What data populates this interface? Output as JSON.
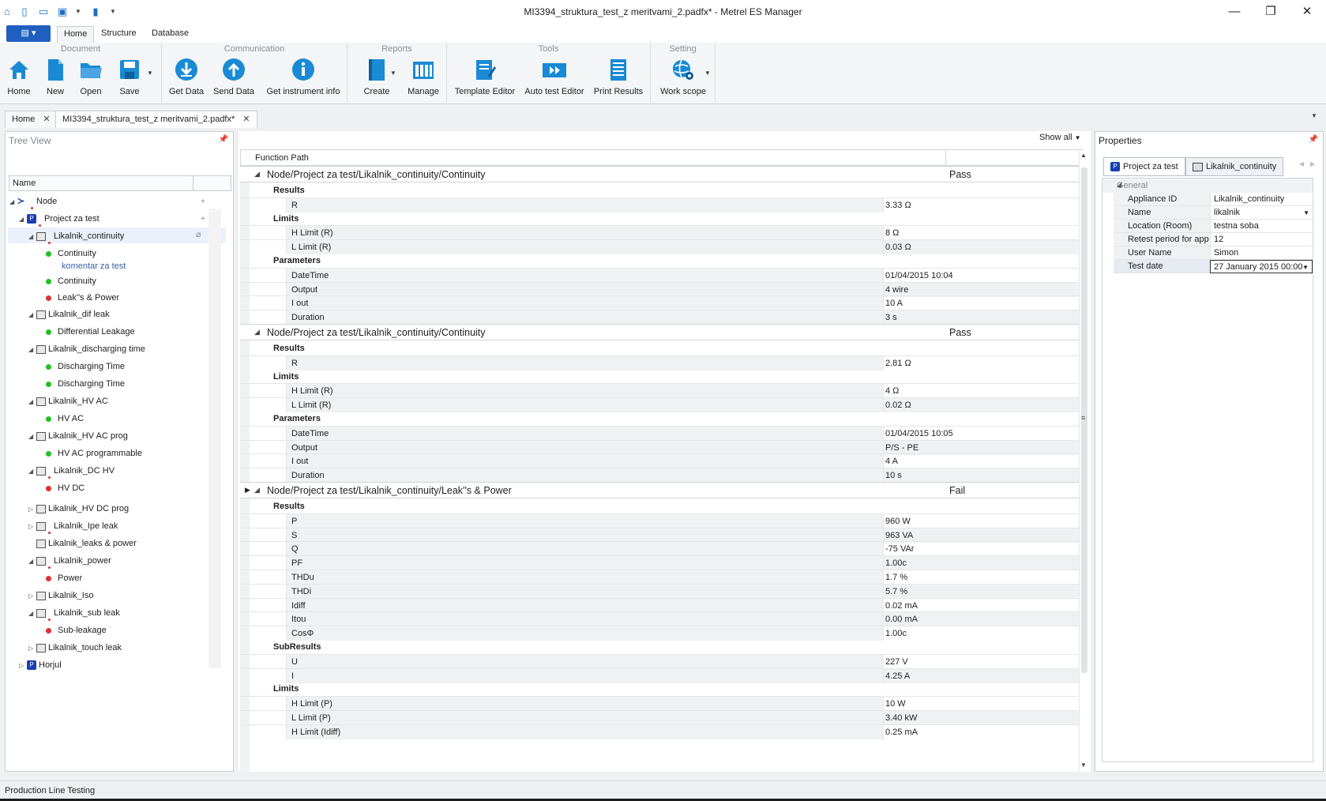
{
  "window": {
    "title": "MI3394_struktura_test_z meritvami_2.padfx* - Metrel ES Manager"
  },
  "ribbon": {
    "tabs": [
      "Home",
      "Structure",
      "Database"
    ],
    "groups": {
      "document": {
        "title": "Document",
        "buttons": [
          "Home",
          "New",
          "Open",
          "Save"
        ]
      },
      "communication": {
        "title": "Communication",
        "buttons": [
          "Get Data",
          "Send Data",
          "Get instrument info"
        ]
      },
      "reports": {
        "title": "Reports",
        "buttons": [
          "Create",
          "Manage"
        ]
      },
      "tools": {
        "title": "Tools",
        "buttons": [
          "Template Editor",
          "Auto test Editor",
          "Print Results"
        ]
      },
      "setting": {
        "title": "Setting",
        "buttons": [
          "Work scope"
        ]
      }
    }
  },
  "doc_tabs": [
    "Home",
    "MI3394_struktura_test_z meritvami_2.padfx*"
  ],
  "tree": {
    "title": "Tree View",
    "column": "Name",
    "nodes": [
      "Node",
      "Project za test",
      "Likalnik_continuity",
      "Continuity",
      "komentar za test",
      "Continuity",
      "Leak''s & Power",
      "Likalnik_dif leak",
      "Differential Leakage",
      "Likalnik_discharging time",
      "Discharging Time",
      "Discharging Time",
      "Likalnik_HV AC",
      "HV AC",
      "Likalnik_HV AC prog",
      "HV AC programmable",
      "Likalnik_DC HV",
      "HV DC",
      "Likalnik_HV DC prog",
      "Likalnik_Ipe leak",
      "Likalnik_leaks & power",
      "Likalnik_power",
      "Power",
      "Likalnik_Iso",
      "Likalnik_sub leak",
      "Sub-leakage",
      "Likalnik_touch leak",
      "Horjul"
    ]
  },
  "center": {
    "show_all": "Show all",
    "column_header": "Function Path",
    "groups": [
      {
        "path": "Node/Project za test/Likalnik_continuity/Continuity",
        "status": "Pass",
        "sections": [
          {
            "title": "Results",
            "rows": [
              {
                "name": "R",
                "value": "3.33 Ω",
                "result": "Pass"
              }
            ]
          },
          {
            "title": "Limits",
            "rows": [
              {
                "name": "H Limit  (R)",
                "value": "8 Ω",
                "result": ""
              },
              {
                "name": "L Limit  (R)",
                "value": "0.03 Ω",
                "result": ""
              }
            ]
          },
          {
            "title": "Parameters",
            "rows": [
              {
                "name": "DateTime",
                "value": "01/04/2015 10:04",
                "result": ""
              },
              {
                "name": "Output",
                "value": "4 wire",
                "result": ""
              },
              {
                "name": "I out",
                "value": "10 A",
                "result": ""
              },
              {
                "name": "Duration",
                "value": "3 s",
                "result": ""
              }
            ]
          }
        ]
      },
      {
        "path": "Node/Project za test/Likalnik_continuity/Continuity",
        "status": "Pass",
        "sections": [
          {
            "title": "Results",
            "rows": [
              {
                "name": "R",
                "value": "2.81 Ω",
                "result": "Pass"
              }
            ]
          },
          {
            "title": "Limits",
            "rows": [
              {
                "name": "H Limit  (R)",
                "value": "4 Ω",
                "result": ""
              },
              {
                "name": "L Limit  (R)",
                "value": "0.02 Ω",
                "result": ""
              }
            ]
          },
          {
            "title": "Parameters",
            "rows": [
              {
                "name": "DateTime",
                "value": "01/04/2015 10:05",
                "result": ""
              },
              {
                "name": "Output",
                "value": "P/S - PE",
                "result": ""
              },
              {
                "name": "I out",
                "value": "4 A",
                "result": ""
              },
              {
                "name": "Duration",
                "value": "10 s",
                "result": ""
              }
            ]
          }
        ]
      },
      {
        "path": "Node/Project za test/Likalnik_continuity/Leak''s & Power",
        "status": "Fail",
        "sections": [
          {
            "title": "Results",
            "rows": [
              {
                "name": "P",
                "value": "960 W",
                "result": "Fail"
              },
              {
                "name": "S",
                "value": "963 VA",
                "result": ""
              },
              {
                "name": "Q",
                "value": "-75 VAr",
                "result": ""
              },
              {
                "name": "PF",
                "value": "1.00c",
                "result": ""
              },
              {
                "name": "THDu",
                "value": "1.7 %",
                "result": ""
              },
              {
                "name": "THDi",
                "value": "5.7 %",
                "result": ""
              },
              {
                "name": "Idiff",
                "value": "0.02 mA",
                "result": "Fail"
              },
              {
                "name": "Itou",
                "value": "0.00 mA",
                "result": "Fail"
              },
              {
                "name": "CosΦ",
                "value": "1.00c",
                "result": ""
              }
            ]
          },
          {
            "title": "SubResults",
            "rows": [
              {
                "name": "U",
                "value": "227 V",
                "result": ""
              },
              {
                "name": "I",
                "value": "4.25 A",
                "result": ""
              }
            ]
          },
          {
            "title": "Limits",
            "rows": [
              {
                "name": "H Limit  (P)",
                "value": "10 W",
                "result": ""
              },
              {
                "name": "L Limit  (P)",
                "value": "3.40 kW",
                "result": ""
              },
              {
                "name": "H Limit  (Idiff)",
                "value": "0.25 mA",
                "result": ""
              }
            ]
          }
        ]
      }
    ]
  },
  "properties": {
    "title": "Properties",
    "tabs": [
      "Project za test",
      "Likalnik_continuity"
    ],
    "section": "General",
    "fields": [
      {
        "key": "Appliance ID",
        "value": "Likalnik_continuity"
      },
      {
        "key": "Name",
        "value": "likalnik"
      },
      {
        "key": "Location (Room)",
        "value": "testna soba"
      },
      {
        "key": "Retest period for app",
        "value": "12"
      },
      {
        "key": "User Name",
        "value": "Simon"
      },
      {
        "key": "Test date",
        "value": "27 January 2015 00:00"
      }
    ]
  },
  "statusbar": {
    "text": "Production Line Testing"
  },
  "icons": {
    "accent": "#1a8ad4",
    "pass_dot": "#22c022",
    "fail_dot": "#e03030"
  }
}
